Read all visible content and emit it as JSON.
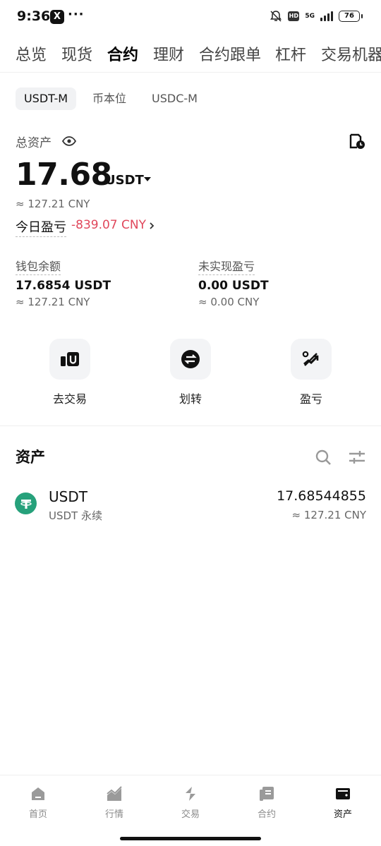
{
  "status_bar": {
    "time": "9:36",
    "x_badge": "X",
    "dots": "···",
    "hd": "HD",
    "net": "5G",
    "battery": "76"
  },
  "top_tabs": [
    {
      "label": "总览"
    },
    {
      "label": "现货"
    },
    {
      "label": "合约"
    },
    {
      "label": "理财"
    },
    {
      "label": "合约跟单"
    },
    {
      "label": "杠杆"
    },
    {
      "label": "交易机器"
    }
  ],
  "active_top_tab": "合约",
  "segments": [
    {
      "label": "USDT-M"
    },
    {
      "label": "币本位"
    },
    {
      "label": "USDC-M"
    }
  ],
  "summary": {
    "total_label": "总资产",
    "total_value": "17.68",
    "total_unit": "USDT",
    "total_cny": "≈ 127.21 CNY",
    "pnl_label": "今日盈亏",
    "pnl_value": "-839.07 CNY",
    "pnl_color": "#e0475b"
  },
  "stats": {
    "wallet_label": "钱包余额",
    "wallet_value": "17.6854 USDT",
    "wallet_cny": "≈ 127.21 CNY",
    "unrealized_label": "未实现盈亏",
    "unrealized_value": "0.00 USDT",
    "unrealized_cny": "≈ 0.00 CNY"
  },
  "actions": [
    {
      "label": "去交易",
      "icon": "trade-icon"
    },
    {
      "label": "划转",
      "icon": "transfer-icon"
    },
    {
      "label": "盈亏",
      "icon": "pnl-icon"
    }
  ],
  "assets": {
    "title": "资产",
    "rows": [
      {
        "symbol": "USDT",
        "sub": "USDT 永续",
        "amount": "17.68544855",
        "cny": "≈ 127.21 CNY",
        "logo_color": "#26a17b"
      }
    ]
  },
  "bottom_nav": [
    {
      "label": "首页",
      "icon": "home-icon"
    },
    {
      "label": "行情",
      "icon": "market-icon"
    },
    {
      "label": "交易",
      "icon": "trade-icon"
    },
    {
      "label": "合约",
      "icon": "futures-icon"
    },
    {
      "label": "资产",
      "icon": "wallet-icon"
    }
  ],
  "active_bottom_nav": "资产"
}
